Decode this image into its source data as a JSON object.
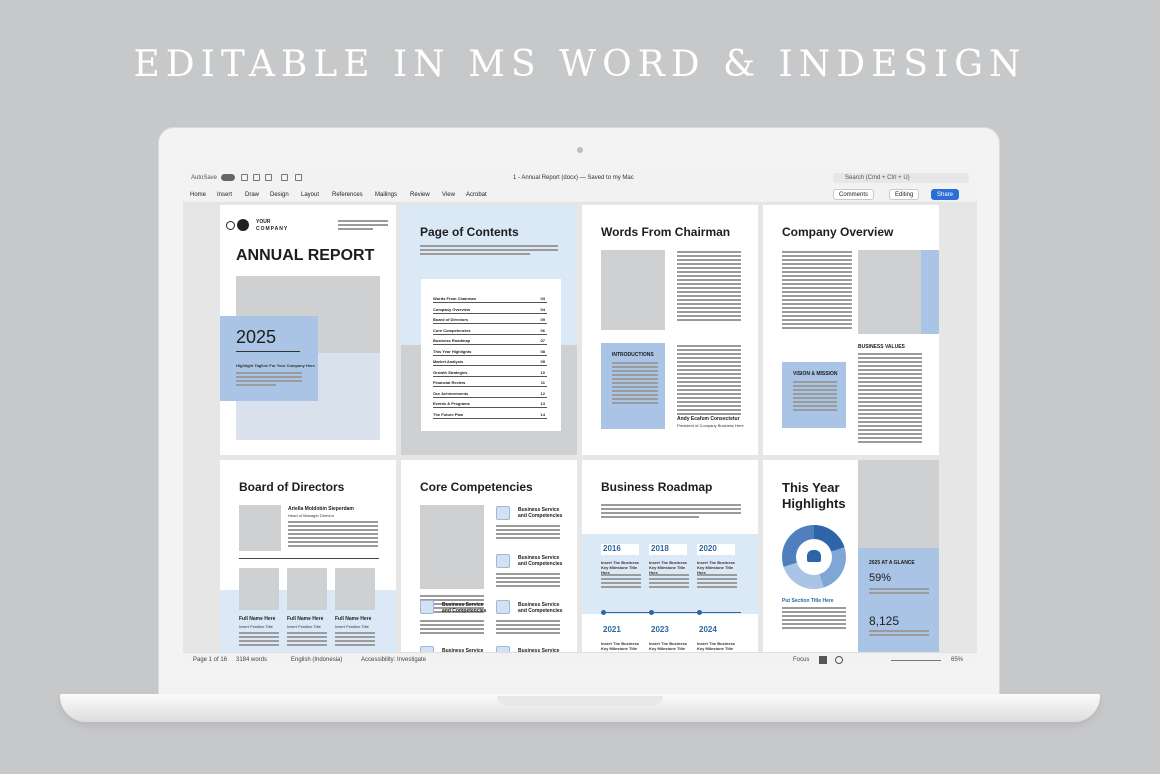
{
  "headline": "EDITABLE IN MS WORD & INDESIGN",
  "word": {
    "autosave_label": "AutoSave",
    "doc_title": "1 - Annual Report (docx) — Saved to my Mac",
    "search_placeholder": "Search (Cmd + Ctrl + U)",
    "tabs": [
      "Home",
      "Insert",
      "Draw",
      "Design",
      "Layout",
      "References",
      "Mailings",
      "Review",
      "View",
      "Acrobat"
    ],
    "comments_label": "Comments",
    "editing_label": "Editing",
    "share_label": "Share",
    "status": {
      "page": "Page 1 of 16",
      "words": "3184 words",
      "language": "English (Indonesia)",
      "accessibility": "Accessibility: Investigate",
      "focus": "Focus",
      "zoom": "65%"
    }
  },
  "pages": {
    "cover": {
      "company_top": "YOUR",
      "company_bottom": "COMPANY",
      "title": "ANNUAL REPORT",
      "year": "2025",
      "subtitle": "Highlight Tagline For Your Company Here"
    },
    "contents": {
      "title": "Page of Contents",
      "items": [
        {
          "label": "Words From Chairman",
          "page": "03"
        },
        {
          "label": "Company Overview",
          "page": "04"
        },
        {
          "label": "Board of Directors",
          "page": "05"
        },
        {
          "label": "Core Competencies",
          "page": "06"
        },
        {
          "label": "Business Roadmap",
          "page": "07"
        },
        {
          "label": "This Year Highlights",
          "page": "08"
        },
        {
          "label": "Market Analysis",
          "page": "09"
        },
        {
          "label": "Growth Strategies",
          "page": "10"
        },
        {
          "label": "Financial Review",
          "page": "11"
        },
        {
          "label": "Our Achievements",
          "page": "12"
        },
        {
          "label": "Events & Programs",
          "page": "13"
        },
        {
          "label": "The Future Plan",
          "page": "14"
        }
      ]
    },
    "chairman": {
      "title": "Words From Chairman",
      "intro": "INTRODUCTIONS",
      "name": "Andy Ecafum Consectetur",
      "position": "President of Company Business Here"
    },
    "overview": {
      "title": "Company Overview",
      "values": "BUSINESS VALUES",
      "vision": "VISION & MISSION"
    },
    "board": {
      "title": "Board of Directors",
      "name": "Ariella Moldobin Sieperdam",
      "role": "Head of Manager Director",
      "member_name": "Full Name Here",
      "member_role": "Insert Position Title"
    },
    "competencies": {
      "title": "Core Competencies",
      "item": "Business Service and Competencies"
    },
    "roadmap": {
      "title": "Business Roadmap",
      "years_top": [
        "2016",
        "2018",
        "2020"
      ],
      "years_bottom": [
        "2021",
        "2023",
        "2024"
      ],
      "milestone": "Insert The Business Key Milestone Title Here"
    },
    "highlights": {
      "title_line1": "This Year",
      "title_line2": "Highlights",
      "glance": "2025 AT A GLANCE",
      "percent": "59%",
      "number": "8,125",
      "section": "Put Section Title Here"
    }
  }
}
